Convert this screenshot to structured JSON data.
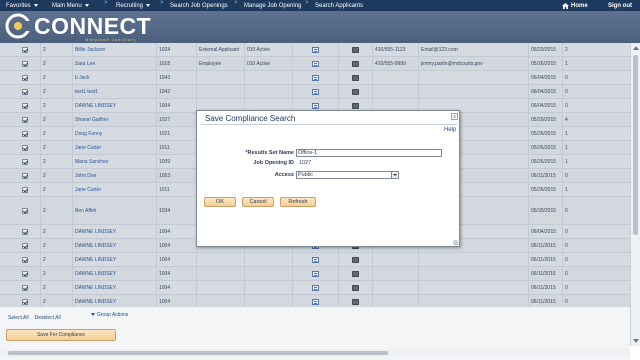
{
  "nav": {
    "favorites": "Favorites",
    "main_menu": "Main Menu",
    "recruiting": "Recruiting",
    "crumbs": [
      "Search Job Openings",
      "Manage Job Opening",
      "Search Applicants"
    ],
    "home": "Home",
    "sign_out": "Sign out"
  },
  "header": {
    "logo": "CONNECT",
    "subtitle": "Maryland Judiciary"
  },
  "rows": [
    {
      "num": "2",
      "name": "Billie Jackson",
      "id": "1024",
      "type": "External Applicant",
      "status": "010 Active",
      "phone": "410/555-1123",
      "email": "Email@123.com",
      "date": "05/29/2015",
      "count": "2"
    },
    {
      "num": "2",
      "name": "Sara Lee",
      "id": "1018",
      "type": "Employee",
      "status": "010 Active",
      "phone": "410/555-9999",
      "email": "jimmy.partin@mdcourts.gov",
      "date": "05/26/2015",
      "count": "1"
    },
    {
      "num": "2",
      "name": "b Jack",
      "id": "1043",
      "type": "",
      "status": "",
      "phone": "",
      "email": "",
      "date": "06/04/2015",
      "count": "0"
    },
    {
      "num": "2",
      "name": "test1 test1",
      "id": "1042",
      "type": "",
      "status": "",
      "phone": "",
      "email": "",
      "date": "06/04/2015",
      "count": "0"
    },
    {
      "num": "2",
      "name": "DAWNE LINDSEY",
      "id": "1004",
      "type": "",
      "status": "",
      "phone": "",
      "email": "",
      "date": "06/04/2015",
      "count": "0"
    },
    {
      "num": "2",
      "name": "Shanel Gaither",
      "id": "1027",
      "type": "",
      "status": "",
      "phone": "",
      "email": "dcourts.gov",
      "date": "05/29/2015",
      "count": "4"
    },
    {
      "num": "2",
      "name": "Doug Funny",
      "id": "1021",
      "type": "",
      "status": "",
      "phone": "",
      "email": "dcourts.gov",
      "date": "05/26/2015",
      "count": "1"
    },
    {
      "num": "2",
      "name": "Jane Carter",
      "id": "1011",
      "type": "",
      "status": "",
      "phone": "",
      "email": "dcourts.gov",
      "date": "05/26/2015",
      "count": "1"
    },
    {
      "num": "2",
      "name": "Maria Sanchez",
      "id": "1009",
      "type": "",
      "status": "",
      "phone": "",
      "email": "dcourts.gov",
      "date": "05/26/2015",
      "count": "1"
    },
    {
      "num": "2",
      "name": "John Doe",
      "id": "1053",
      "type": "",
      "status": "",
      "phone": "",
      "email": "",
      "date": "06/11/2015",
      "count": "0"
    },
    {
      "num": "2",
      "name": "Jane Carter",
      "id": "1011",
      "type": "",
      "status": "",
      "phone": "",
      "email": "dcourts.gov",
      "date": "05/26/2015",
      "count": "1"
    },
    {
      "num": "2",
      "name": "Ben Affek",
      "id": "1034",
      "type": "",
      "status": "",
      "phone": "",
      "email": "om",
      "date": "05/30/2015",
      "count": "0",
      "tall": true
    },
    {
      "num": "2",
      "name": "DAWNE LINDSEY",
      "id": "1004",
      "type": "",
      "status": "",
      "phone": "",
      "email": "",
      "date": "06/04/2015",
      "count": "0"
    },
    {
      "num": "2",
      "name": "DAWNE LINDSEY",
      "id": "1004",
      "type": "",
      "status": "",
      "phone": "",
      "email": "",
      "date": "06/11/2015",
      "count": "0"
    },
    {
      "num": "2",
      "name": "DAWNE LINDSEY",
      "id": "1004",
      "type": "",
      "status": "",
      "phone": "",
      "email": "",
      "date": "06/11/2015",
      "count": "0"
    },
    {
      "num": "2",
      "name": "DAWNE LINDSEY",
      "id": "1004",
      "type": "",
      "status": "",
      "phone": "",
      "email": "",
      "date": "06/11/2015",
      "count": "0"
    },
    {
      "num": "2",
      "name": "DAWNE LINDSEY",
      "id": "1004",
      "type": "",
      "status": "",
      "phone": "",
      "email": "",
      "date": "06/11/2015",
      "count": "0"
    },
    {
      "num": "2",
      "name": "DAWNE LINDSEY",
      "id": "1004",
      "type": "",
      "status": "",
      "phone": "",
      "email": "",
      "date": "06/11/2015",
      "count": "0"
    }
  ],
  "footer": {
    "select_all": "Select All",
    "deselect_all": "Deselect All",
    "group_actions": "Group Actions",
    "save_for_compliance": "Save For Compliance"
  },
  "modal": {
    "title": "Save Compliance Search",
    "close": "x",
    "help": "Help",
    "results_set_name_label": "*Results Set Name",
    "results_set_name_value": "Office-1",
    "job_opening_id_label": "Job Opening ID",
    "job_opening_id_value": "1027",
    "access_label": "Access",
    "access_value": "Public",
    "ok": "OK",
    "cancel": "Cancel",
    "refresh": "Refresh"
  },
  "colors": {
    "nav_bg": "#1d3a5e",
    "header_bg": "#556a88",
    "row_bg": "#e2e7ed",
    "link": "#1f4d9a",
    "button_bg": "#f4cf96"
  }
}
